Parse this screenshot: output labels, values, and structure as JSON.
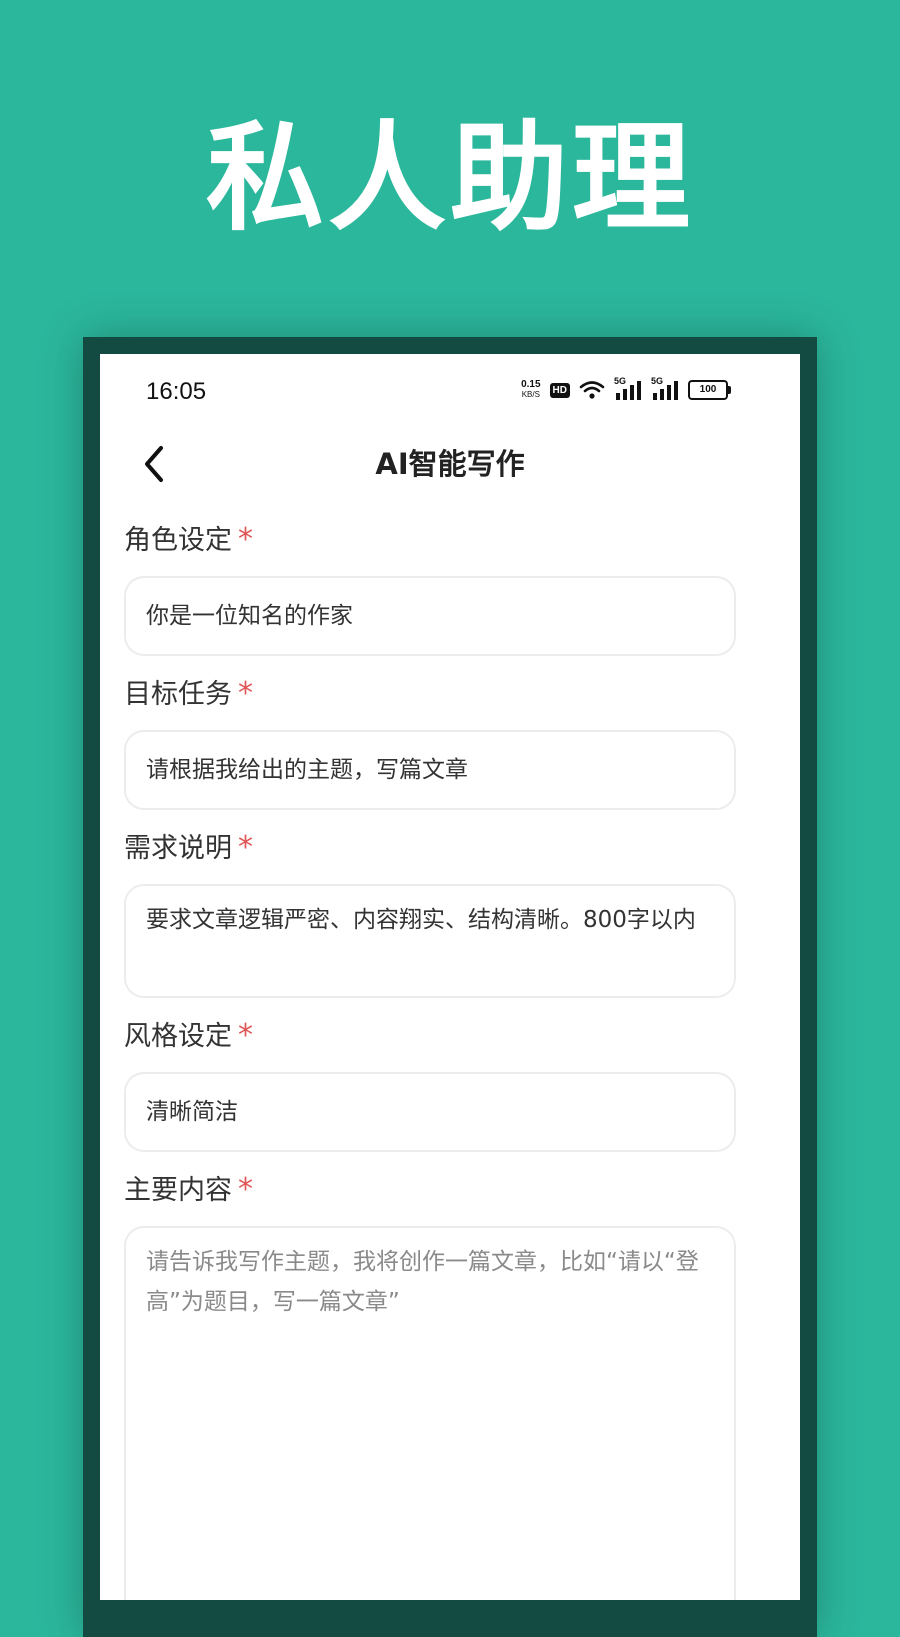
{
  "banner": {
    "title": "私人助理"
  },
  "status_bar": {
    "time": "16:05",
    "net_speed_value": "0.15",
    "net_speed_unit": "KB/S",
    "hd_label": "HD",
    "sim1_label": "5G",
    "sim2_label": "5G",
    "battery_level": "100"
  },
  "header": {
    "title": "AI智能写作"
  },
  "form": {
    "required_mark": "*",
    "role": {
      "label": "角色设定",
      "value": "你是一位知名的作家"
    },
    "task": {
      "label": "目标任务",
      "value": "请根据我给出的主题，写篇文章"
    },
    "requirements": {
      "label": "需求说明",
      "value": "要求文章逻辑严密、内容翔实、结构清晰。800字以内"
    },
    "style": {
      "label": "风格设定",
      "value": "清晰简洁"
    },
    "content": {
      "label": "主要内容",
      "placeholder": "请告诉我写作主题，我将创作一篇文章，比如“请以“登高”为题目，写一篇文章”"
    }
  },
  "colors": {
    "background": "#2bb79c",
    "frame": "#134a42",
    "required": "#e05555"
  }
}
